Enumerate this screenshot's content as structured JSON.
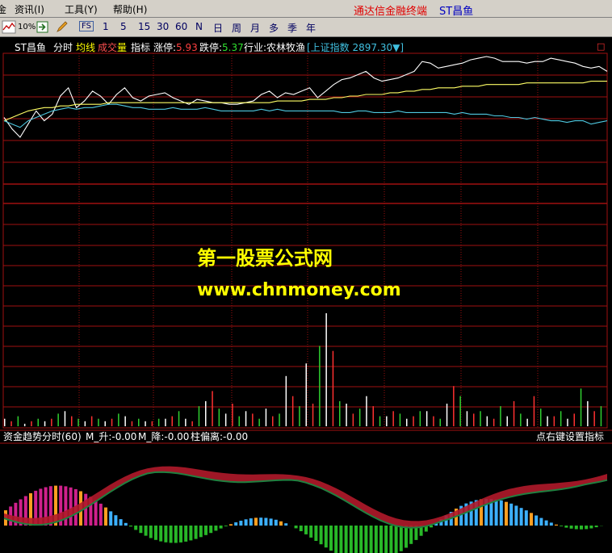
{
  "menu": {
    "items": [
      "金",
      "资讯(I)",
      "工具(Y)",
      "帮助(H)"
    ],
    "app_title": "通达信金融终端",
    "stock_title": "ST昌鱼"
  },
  "toolbar": {
    "percent_label": "10%",
    "fs_label": "FS",
    "periods": [
      "1",
      "5",
      "15",
      "30",
      "60",
      "N",
      "日",
      "周",
      "月",
      "多",
      "季",
      "年"
    ]
  },
  "chart_header": {
    "stock_name": "ST昌鱼",
    "mode": "分时",
    "avg_label": "均线",
    "vol_a": "成交",
    "vol_b": "量",
    "indicator": "指标",
    "limit_up_label": "涨停:",
    "limit_up_value": "5.93",
    "limit_down_label": "跌停:",
    "limit_down_value": "5.37",
    "industry": "行业:农林牧渔",
    "index_text": "[上证指数 2897.30▼]",
    "corner_mark": "□"
  },
  "watermark": {
    "line1": "第一股票公式网",
    "line2": "www.chnmoney.com"
  },
  "sub_chart": {
    "title": "资金趋势分时(60)",
    "m_up": "M_升:-0.00",
    "m_down": "M_降:-0.00",
    "bias": "柱偏离:-0.00",
    "right_hint": "点右键设置指标"
  },
  "chart_data": [
    {
      "type": "line",
      "panel": "price",
      "series": [
        {
          "color": "#ffffff",
          "values": [
            0.62,
            0.55,
            0.5,
            0.58,
            0.66,
            0.6,
            0.64,
            0.75,
            0.8,
            0.68,
            0.72,
            0.78,
            0.75,
            0.7,
            0.76,
            0.8,
            0.74,
            0.72,
            0.75,
            0.76,
            0.77,
            0.74,
            0.72,
            0.7,
            0.73,
            0.72,
            0.71,
            0.71,
            0.7,
            0.7,
            0.71,
            0.72,
            0.76,
            0.78,
            0.74,
            0.77,
            0.76,
            0.78,
            0.8,
            0.74,
            0.78,
            0.82,
            0.85,
            0.86,
            0.88,
            0.9,
            0.86,
            0.84,
            0.85,
            0.86,
            0.88,
            0.9,
            0.96,
            0.95,
            0.92,
            0.93,
            0.94,
            0.95,
            0.97,
            0.98,
            0.99,
            0.98,
            0.96,
            0.96,
            0.96,
            0.95,
            0.96,
            0.96,
            0.98,
            0.97,
            0.96,
            0.95,
            0.93,
            0.92,
            0.93,
            0.9
          ]
        },
        {
          "color": "#ffff66",
          "values": [
            0.6,
            0.62,
            0.64,
            0.66,
            0.67,
            0.68,
            0.68,
            0.69,
            0.69,
            0.7,
            0.7,
            0.7,
            0.7,
            0.71,
            0.71,
            0.71,
            0.71,
            0.71,
            0.71,
            0.71,
            0.71,
            0.71,
            0.71,
            0.71,
            0.71,
            0.71,
            0.71,
            0.71,
            0.71,
            0.71,
            0.71,
            0.71,
            0.71,
            0.71,
            0.72,
            0.72,
            0.72,
            0.72,
            0.73,
            0.73,
            0.73,
            0.74,
            0.74,
            0.75,
            0.75,
            0.76,
            0.76,
            0.76,
            0.77,
            0.77,
            0.78,
            0.78,
            0.79,
            0.79,
            0.8,
            0.8,
            0.8,
            0.81,
            0.81,
            0.81,
            0.82,
            0.82,
            0.82,
            0.82,
            0.82,
            0.83,
            0.83,
            0.83,
            0.83,
            0.83,
            0.83,
            0.83,
            0.83,
            0.84,
            0.84,
            0.84
          ]
        },
        {
          "color": "#4fc8e0",
          "values": [
            0.6,
            0.58,
            0.56,
            0.6,
            0.62,
            0.64,
            0.66,
            0.67,
            0.68,
            0.67,
            0.68,
            0.68,
            0.69,
            0.7,
            0.7,
            0.69,
            0.68,
            0.68,
            0.67,
            0.67,
            0.67,
            0.68,
            0.67,
            0.67,
            0.67,
            0.68,
            0.67,
            0.66,
            0.66,
            0.66,
            0.66,
            0.66,
            0.67,
            0.66,
            0.67,
            0.66,
            0.66,
            0.66,
            0.66,
            0.66,
            0.66,
            0.66,
            0.65,
            0.65,
            0.66,
            0.66,
            0.65,
            0.65,
            0.65,
            0.66,
            0.65,
            0.65,
            0.65,
            0.65,
            0.65,
            0.65,
            0.64,
            0.65,
            0.64,
            0.64,
            0.64,
            0.63,
            0.63,
            0.62,
            0.62,
            0.61,
            0.62,
            0.61,
            0.6,
            0.6,
            0.59,
            0.6,
            0.6,
            0.58,
            0.59,
            0.6
          ]
        }
      ]
    },
    {
      "type": "bar",
      "panel": "volume",
      "values": [
        3,
        2,
        4,
        1,
        2,
        3,
        2,
        3,
        5,
        6,
        4,
        3,
        2,
        4,
        3,
        2,
        3,
        5,
        4,
        2,
        3,
        2,
        2,
        3,
        3,
        4,
        6,
        3,
        2,
        8,
        10,
        14,
        7,
        5,
        9,
        4,
        6,
        5,
        3,
        7,
        4,
        5,
        20,
        12,
        8,
        25,
        9,
        32,
        45,
        30,
        10,
        9,
        5,
        7,
        12,
        8,
        4,
        4,
        6,
        5,
        3,
        4,
        6,
        6,
        4,
        3,
        9,
        16,
        12,
        6,
        5,
        6,
        4,
        3,
        8,
        4,
        10,
        5,
        3,
        12,
        7,
        4,
        4,
        6,
        3,
        5,
        15,
        10,
        6,
        8
      ]
    },
    {
      "type": "area",
      "panel": "indicator",
      "series": [
        {
          "name": "M_升",
          "color": "#d02030"
        },
        {
          "name": "M_降",
          "color": "#208040"
        }
      ]
    }
  ]
}
